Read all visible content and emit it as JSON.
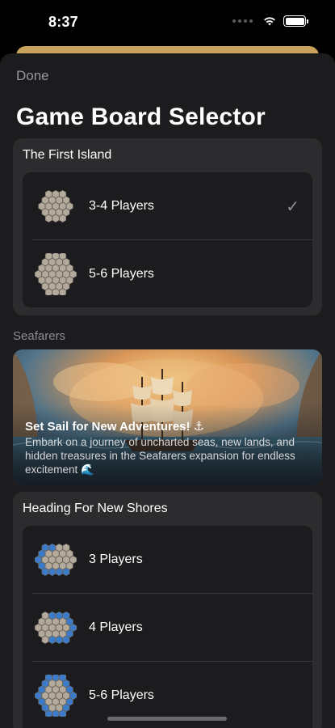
{
  "status_bar": {
    "time": "8:37",
    "battery_level": 1.0
  },
  "navigation": {
    "done_label": "Done",
    "page_title": "Game Board Selector"
  },
  "first_island": {
    "title": "The First Island",
    "options": [
      {
        "label": "3-4 Players",
        "selected": true,
        "board_icon": "hex-board-icon"
      },
      {
        "label": "5-6 Players",
        "selected": false,
        "board_icon": "hex-board-icon"
      }
    ],
    "checkmark": "✓"
  },
  "seafarers": {
    "section_label": "Seafarers",
    "banner": {
      "title": "Set Sail for New Adventures! ⚓",
      "description": "Embark on a journey of uncharted seas, new lands, and hidden treasures in the Seafarers expansion for endless excitement 🌊"
    }
  },
  "heading_new_shores": {
    "title": "Heading For New Shores",
    "options": [
      {
        "label": "3 Players",
        "board_icon": "sea-hex-board-icon"
      },
      {
        "label": "4 Players",
        "board_icon": "sea-hex-board-icon"
      },
      {
        "label": "5-6 Players",
        "board_icon": "sea-hex-board-icon"
      }
    ]
  },
  "colors": {
    "sheet_bg": "#1c1c1e",
    "card_bg": "#2c2c2e",
    "hex_land": "#b3aa9c",
    "hex_sea": "#3c7bc9",
    "accent_gold": "#c9a35b"
  }
}
